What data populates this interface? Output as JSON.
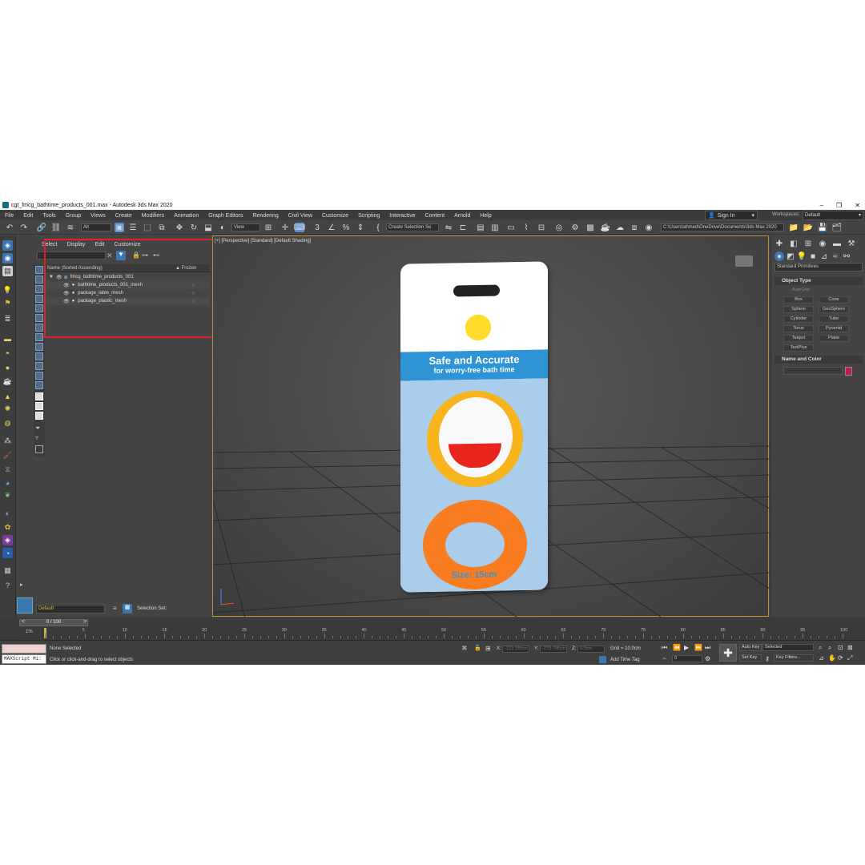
{
  "window": {
    "title": "cgt_fmcg_bathtime_products_001.max - Autodesk 3ds Max 2020",
    "controls": [
      "–",
      "❐",
      "✕"
    ]
  },
  "menu": [
    "File",
    "Edit",
    "Tools",
    "Group",
    "Views",
    "Create",
    "Modifiers",
    "Animation",
    "Graph Editors",
    "Rendering",
    "Civil View",
    "Customize",
    "Scripting",
    "Interactive",
    "Content",
    "Arnold",
    "Help"
  ],
  "account": {
    "sign_in": "Sign In",
    "workspaces_label": "Workspaces:",
    "workspace": "Default"
  },
  "toolbar": {
    "filter_value": "All",
    "view_value": "View",
    "selection_set_placeholder": "Create Selection Se",
    "path": "C:\\Users\\ahmed\\OneDrive\\Documents\\3ds Max 2020"
  },
  "scene_explorer": {
    "menus": [
      "Select",
      "Display",
      "Edit",
      "Customize"
    ],
    "columns": {
      "name": "Name (Sorted Ascending)",
      "frozen": "▲ Frozen"
    },
    "items": [
      {
        "label": "fmcg_bathtime_products_001",
        "level": 0
      },
      {
        "label": "bathtime_products_001_mesh",
        "level": 1
      },
      {
        "label": "package_lable_mesh",
        "level": 1
      },
      {
        "label": "package_plastic_mesh",
        "level": 1
      }
    ],
    "layer": "Default",
    "selection_set_label": "Selection Set:"
  },
  "viewport": {
    "label": "[+] [Perspective] [Standard] [Default Shading]",
    "product": {
      "headline": "Safe and Accurate",
      "subline": "for worry-free bath time",
      "size": "Size: 15cm"
    }
  },
  "command_panel": {
    "category": "Standard Primitives",
    "object_type_title": "Object Type",
    "autogrid": "AutoGrid",
    "buttons": [
      "Box",
      "Cone",
      "Sphere",
      "GeoSphere",
      "Cylinder",
      "Tube",
      "Torus",
      "Pyramid",
      "Teapot",
      "Plane",
      "TextPlus"
    ],
    "name_color_title": "Name and Color",
    "color": "#c2185b"
  },
  "timeline": {
    "frame_display": "0 / 100",
    "ticks": [
      "5",
      "10",
      "15",
      "20",
      "25",
      "30",
      "35",
      "40",
      "45",
      "50",
      "55",
      "60",
      "65",
      "70",
      "75",
      "80",
      "85",
      "90",
      "95",
      "100"
    ],
    "marker": "1%"
  },
  "status": {
    "maxscript": "MAXScript Mi:",
    "selection": "None Selected",
    "prompt": "Click or click-and-drag to select objects",
    "x_label": "X:",
    "x_value": "-123.189cm",
    "y_label": "Y:",
    "y_value": "-273.706cm",
    "z_label": "Z:",
    "z_value": "0.0cm",
    "grid": "Grid = 10.0cm",
    "add_time_tag": "Add Time Tag",
    "auto_key": "Auto Key",
    "set_key": "Set Key",
    "selected": "Selected",
    "key_filters": "Key Filters...",
    "frame": "0"
  }
}
